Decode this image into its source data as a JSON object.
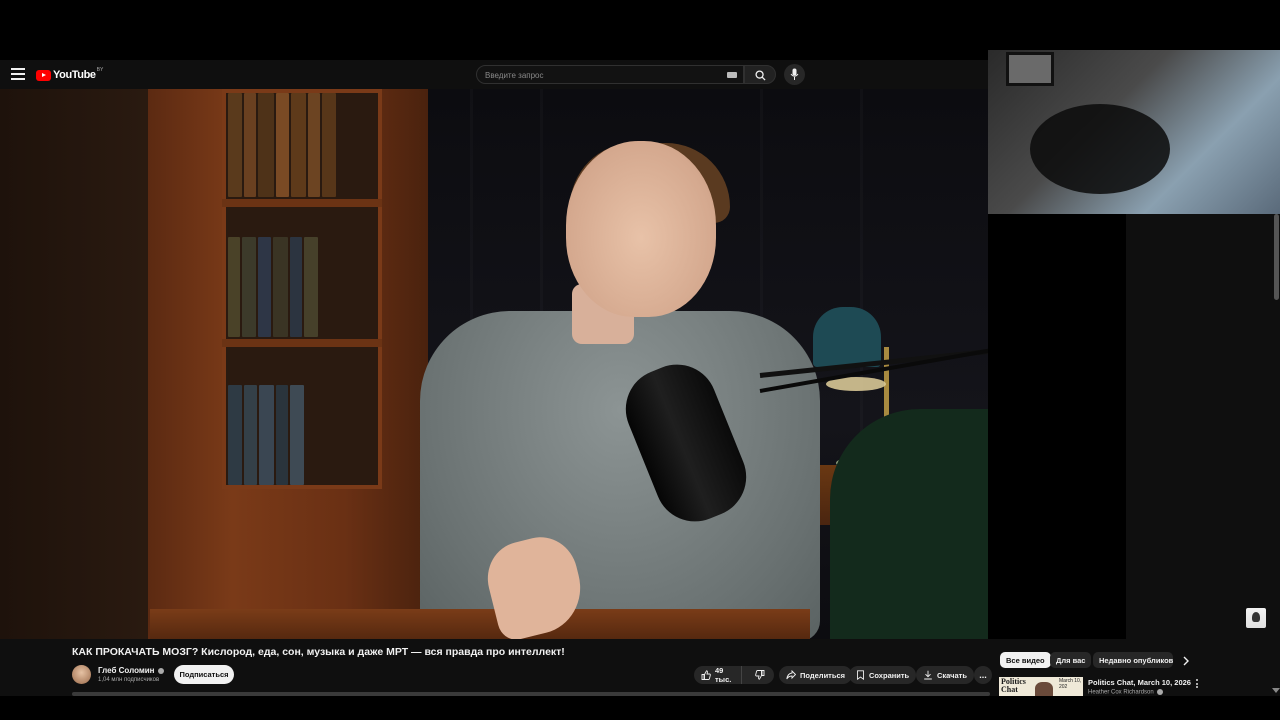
{
  "masthead": {
    "logo_text": "YouTube",
    "logo_country": "BY",
    "search_placeholder": "Введите запрос"
  },
  "video": {
    "title": "КАК ПРОКАЧАТЬ МОЗГ? Кислород, еда, сон, музыка и даже МРТ — вся правда про интеллект!",
    "channel_name": "Глеб Соломин",
    "subscribers": "1,04 млн подписчиков",
    "subscribe_label": "Подписаться",
    "likes": "49 тыс.",
    "share_label": "Поделиться",
    "save_label": "Сохранить",
    "download_label": "Скачать",
    "more_label": "..."
  },
  "sidebar": {
    "chips": [
      "Все видео",
      "Для вас",
      "Недавно опубликованные"
    ],
    "active_chip": 0,
    "recommendation": {
      "thumb_text": "Politics Chat",
      "thumb_date": "March 10, 202",
      "title": "Politics Chat, March 10, 2026",
      "channel": "Heather Cox Richardson"
    }
  },
  "colors": {
    "background": "#0f0f0f",
    "brand": "#ff0000",
    "text": "#f1f1f1",
    "secondary_text": "#aaaaaa",
    "pill": "#272727"
  },
  "icons": [
    "menu-icon",
    "youtube-logo-icon",
    "keyboard-icon",
    "search-icon",
    "mic-icon",
    "like-icon",
    "dislike-icon",
    "share-icon",
    "save-icon",
    "download-icon",
    "more-icon",
    "chevron-right-icon",
    "verified-icon"
  ]
}
